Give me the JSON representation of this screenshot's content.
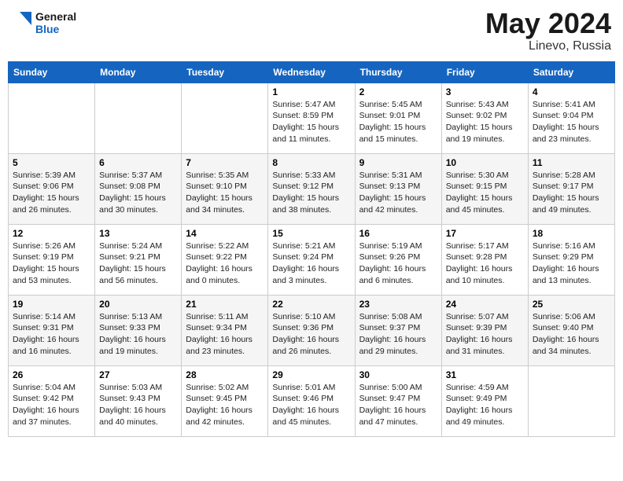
{
  "header": {
    "logo_line1": "General",
    "logo_line2": "Blue",
    "month": "May 2024",
    "location": "Linevo, Russia"
  },
  "weekdays": [
    "Sunday",
    "Monday",
    "Tuesday",
    "Wednesday",
    "Thursday",
    "Friday",
    "Saturday"
  ],
  "weeks": [
    [
      {
        "day": "",
        "info": ""
      },
      {
        "day": "",
        "info": ""
      },
      {
        "day": "",
        "info": ""
      },
      {
        "day": "1",
        "info": "Sunrise: 5:47 AM\nSunset: 8:59 PM\nDaylight: 15 hours\nand 11 minutes."
      },
      {
        "day": "2",
        "info": "Sunrise: 5:45 AM\nSunset: 9:01 PM\nDaylight: 15 hours\nand 15 minutes."
      },
      {
        "day": "3",
        "info": "Sunrise: 5:43 AM\nSunset: 9:02 PM\nDaylight: 15 hours\nand 19 minutes."
      },
      {
        "day": "4",
        "info": "Sunrise: 5:41 AM\nSunset: 9:04 PM\nDaylight: 15 hours\nand 23 minutes."
      }
    ],
    [
      {
        "day": "5",
        "info": "Sunrise: 5:39 AM\nSunset: 9:06 PM\nDaylight: 15 hours\nand 26 minutes."
      },
      {
        "day": "6",
        "info": "Sunrise: 5:37 AM\nSunset: 9:08 PM\nDaylight: 15 hours\nand 30 minutes."
      },
      {
        "day": "7",
        "info": "Sunrise: 5:35 AM\nSunset: 9:10 PM\nDaylight: 15 hours\nand 34 minutes."
      },
      {
        "day": "8",
        "info": "Sunrise: 5:33 AM\nSunset: 9:12 PM\nDaylight: 15 hours\nand 38 minutes."
      },
      {
        "day": "9",
        "info": "Sunrise: 5:31 AM\nSunset: 9:13 PM\nDaylight: 15 hours\nand 42 minutes."
      },
      {
        "day": "10",
        "info": "Sunrise: 5:30 AM\nSunset: 9:15 PM\nDaylight: 15 hours\nand 45 minutes."
      },
      {
        "day": "11",
        "info": "Sunrise: 5:28 AM\nSunset: 9:17 PM\nDaylight: 15 hours\nand 49 minutes."
      }
    ],
    [
      {
        "day": "12",
        "info": "Sunrise: 5:26 AM\nSunset: 9:19 PM\nDaylight: 15 hours\nand 53 minutes."
      },
      {
        "day": "13",
        "info": "Sunrise: 5:24 AM\nSunset: 9:21 PM\nDaylight: 15 hours\nand 56 minutes."
      },
      {
        "day": "14",
        "info": "Sunrise: 5:22 AM\nSunset: 9:22 PM\nDaylight: 16 hours\nand 0 minutes."
      },
      {
        "day": "15",
        "info": "Sunrise: 5:21 AM\nSunset: 9:24 PM\nDaylight: 16 hours\nand 3 minutes."
      },
      {
        "day": "16",
        "info": "Sunrise: 5:19 AM\nSunset: 9:26 PM\nDaylight: 16 hours\nand 6 minutes."
      },
      {
        "day": "17",
        "info": "Sunrise: 5:17 AM\nSunset: 9:28 PM\nDaylight: 16 hours\nand 10 minutes."
      },
      {
        "day": "18",
        "info": "Sunrise: 5:16 AM\nSunset: 9:29 PM\nDaylight: 16 hours\nand 13 minutes."
      }
    ],
    [
      {
        "day": "19",
        "info": "Sunrise: 5:14 AM\nSunset: 9:31 PM\nDaylight: 16 hours\nand 16 minutes."
      },
      {
        "day": "20",
        "info": "Sunrise: 5:13 AM\nSunset: 9:33 PM\nDaylight: 16 hours\nand 19 minutes."
      },
      {
        "day": "21",
        "info": "Sunrise: 5:11 AM\nSunset: 9:34 PM\nDaylight: 16 hours\nand 23 minutes."
      },
      {
        "day": "22",
        "info": "Sunrise: 5:10 AM\nSunset: 9:36 PM\nDaylight: 16 hours\nand 26 minutes."
      },
      {
        "day": "23",
        "info": "Sunrise: 5:08 AM\nSunset: 9:37 PM\nDaylight: 16 hours\nand 29 minutes."
      },
      {
        "day": "24",
        "info": "Sunrise: 5:07 AM\nSunset: 9:39 PM\nDaylight: 16 hours\nand 31 minutes."
      },
      {
        "day": "25",
        "info": "Sunrise: 5:06 AM\nSunset: 9:40 PM\nDaylight: 16 hours\nand 34 minutes."
      }
    ],
    [
      {
        "day": "26",
        "info": "Sunrise: 5:04 AM\nSunset: 9:42 PM\nDaylight: 16 hours\nand 37 minutes."
      },
      {
        "day": "27",
        "info": "Sunrise: 5:03 AM\nSunset: 9:43 PM\nDaylight: 16 hours\nand 40 minutes."
      },
      {
        "day": "28",
        "info": "Sunrise: 5:02 AM\nSunset: 9:45 PM\nDaylight: 16 hours\nand 42 minutes."
      },
      {
        "day": "29",
        "info": "Sunrise: 5:01 AM\nSunset: 9:46 PM\nDaylight: 16 hours\nand 45 minutes."
      },
      {
        "day": "30",
        "info": "Sunrise: 5:00 AM\nSunset: 9:47 PM\nDaylight: 16 hours\nand 47 minutes."
      },
      {
        "day": "31",
        "info": "Sunrise: 4:59 AM\nSunset: 9:49 PM\nDaylight: 16 hours\nand 49 minutes."
      },
      {
        "day": "",
        "info": ""
      }
    ]
  ]
}
